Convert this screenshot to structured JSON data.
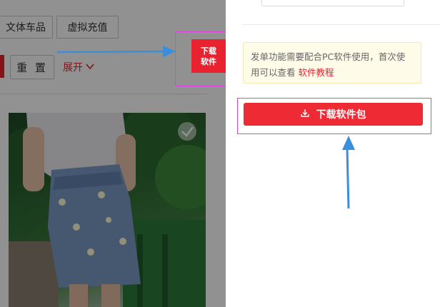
{
  "filters": {
    "category_1": "文体车品",
    "category_2": "虚拟充值",
    "reset_label": "重 置",
    "expand_label": "展开"
  },
  "download_small": {
    "line1": "下载",
    "line2": "软件"
  },
  "panel": {
    "notice_text": "发单功能需要配合PC软件使用，首次使用可以查看",
    "notice_link": "软件教程",
    "download_button_label": "下载软件包"
  },
  "colors": {
    "brand_red": "#ee2a34",
    "annotation_magenta": "#e23de6",
    "annotation_arrow": "#3a8fdc",
    "notice_bg": "#fffbe9"
  }
}
